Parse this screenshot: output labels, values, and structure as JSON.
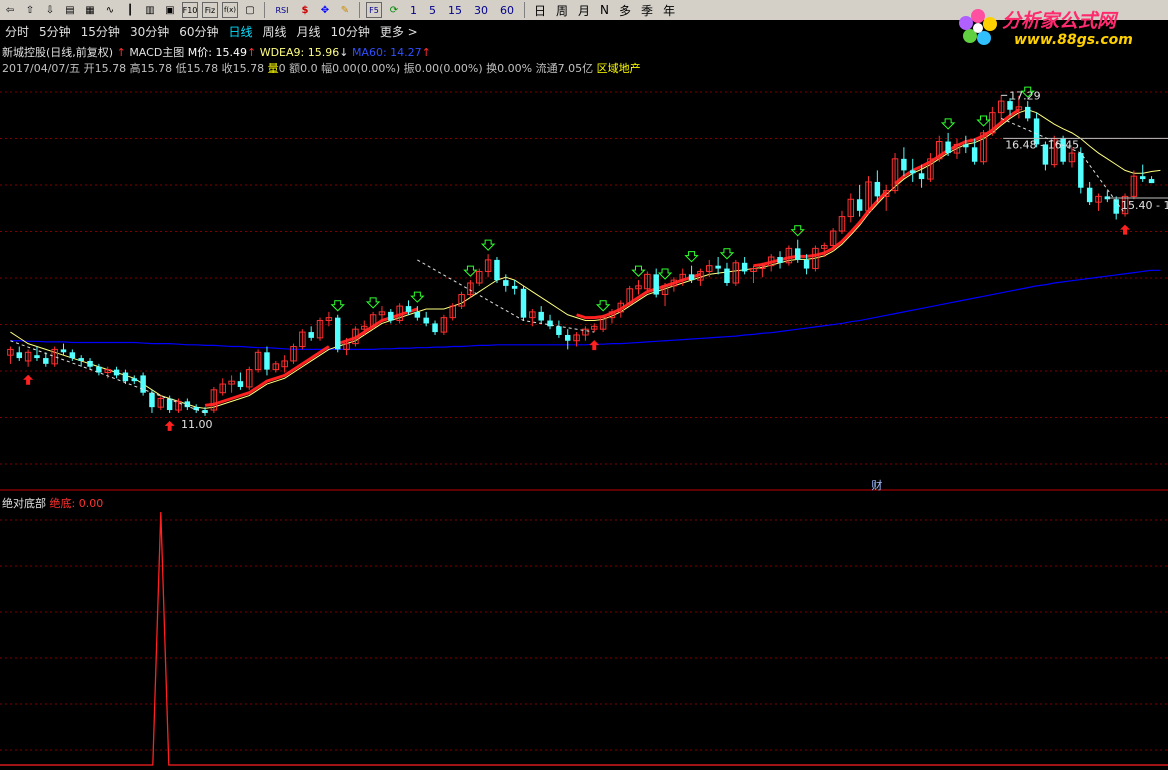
{
  "toolbar": {
    "icons": [
      "back-icon",
      "up-icon",
      "down-icon",
      "report-icon",
      "grid-icon",
      "line-icon",
      "candle-icon",
      "bar-icon",
      "doc-icon",
      "f10-icon",
      "fiz-icon",
      "fx-icon",
      "box-icon",
      "rsi-icon",
      "money-icon",
      "move-icon",
      "draw-icon",
      "f5-icon",
      "refresh-icon"
    ],
    "rsi_label": "RSI",
    "f10_label": "F10",
    "fiz_label": "Fiz",
    "fx_label": "f(x)",
    "f5_label": "F5",
    "minute_buttons": [
      "1",
      "5",
      "15",
      "30",
      "60"
    ],
    "period_buttons": [
      "日",
      "周",
      "月",
      "N",
      "多",
      "季",
      "年"
    ]
  },
  "periods": [
    "分时",
    "5分钟",
    "15分钟",
    "30分钟",
    "60分钟",
    "日线",
    "周线",
    "月线",
    "10分钟",
    "更多 >"
  ],
  "active_period": "日线",
  "logo": {
    "title": "分析家公式网",
    "url": "www.88gs.com"
  },
  "legend": {
    "stock": "新城控股(日线,前复权)",
    "arrow_up": "↑",
    "indicator": "MACD主图",
    "m_price": "M价: 15.49",
    "m_arrow": "↑",
    "wdea": "WDEA9: 15.96",
    "wdea_arrow": "↓",
    "ma60": "MA60: 14.27",
    "ma60_arrow": "↑"
  },
  "info": {
    "date": "2017/04/07/五",
    "open": "开15.78",
    "high": "高15.78",
    "low": "低15.78",
    "close": "收15.78",
    "vol_label": "量",
    "vol": "0",
    "amount": "额0.0",
    "range": "幅0.00(0.00%)",
    "amp": "振0.00(0.00%)",
    "turnover": "换0.00%",
    "float": "流通7.05亿",
    "sector": "区域地产"
  },
  "annotations": {
    "high_price": "17.29",
    "low_price": "11.00",
    "upper_range": "16.48 - 16.45",
    "lower_range": "15.40 - 15.",
    "cai_marker": "财"
  },
  "sub_legend": {
    "name": "绝对底部",
    "value": "绝底: 0.00"
  },
  "colors": {
    "up": "#ff3030",
    "down": "#54ffff",
    "ma_yellow": "#ffff80",
    "ma_blue": "#0000ff",
    "red_line": "#ff2020",
    "grid": "#800000"
  },
  "chart_data": {
    "type": "candlestick",
    "y_range": [
      10.5,
      17.6
    ],
    "candles": [
      {
        "o": 12.8,
        "h": 12.95,
        "l": 12.65,
        "c": 12.9
      },
      {
        "o": 12.85,
        "h": 12.95,
        "l": 12.7,
        "c": 12.75
      },
      {
        "o": 12.7,
        "h": 12.9,
        "l": 12.6,
        "c": 12.85
      },
      {
        "o": 12.8,
        "h": 12.95,
        "l": 12.7,
        "c": 12.75
      },
      {
        "o": 12.75,
        "h": 12.85,
        "l": 12.6,
        "c": 12.65
      },
      {
        "o": 12.65,
        "h": 12.95,
        "l": 12.6,
        "c": 12.9
      },
      {
        "o": 12.9,
        "h": 13.0,
        "l": 12.8,
        "c": 12.85
      },
      {
        "o": 12.85,
        "h": 12.9,
        "l": 12.7,
        "c": 12.75
      },
      {
        "o": 12.75,
        "h": 12.8,
        "l": 12.6,
        "c": 12.7
      },
      {
        "o": 12.7,
        "h": 12.75,
        "l": 12.55,
        "c": 12.6
      },
      {
        "o": 12.6,
        "h": 12.65,
        "l": 12.45,
        "c": 12.5
      },
      {
        "o": 12.5,
        "h": 12.6,
        "l": 12.4,
        "c": 12.55
      },
      {
        "o": 12.55,
        "h": 12.6,
        "l": 12.4,
        "c": 12.45
      },
      {
        "o": 12.5,
        "h": 12.55,
        "l": 12.3,
        "c": 12.35
      },
      {
        "o": 12.4,
        "h": 12.45,
        "l": 12.3,
        "c": 12.35
      },
      {
        "o": 12.45,
        "h": 12.5,
        "l": 12.1,
        "c": 12.15
      },
      {
        "o": 12.15,
        "h": 12.2,
        "l": 11.8,
        "c": 11.9
      },
      {
        "o": 11.9,
        "h": 12.1,
        "l": 11.85,
        "c": 12.05
      },
      {
        "o": 12.05,
        "h": 12.1,
        "l": 11.8,
        "c": 11.85
      },
      {
        "o": 11.85,
        "h": 12.05,
        "l": 11.8,
        "c": 12.0
      },
      {
        "o": 12.0,
        "h": 12.05,
        "l": 11.85,
        "c": 11.9
      },
      {
        "o": 11.9,
        "h": 11.95,
        "l": 11.8,
        "c": 11.85
      },
      {
        "o": 11.85,
        "h": 11.9,
        "l": 11.75,
        "c": 11.8
      },
      {
        "o": 11.85,
        "h": 12.25,
        "l": 11.8,
        "c": 12.2
      },
      {
        "o": 12.15,
        "h": 12.4,
        "l": 12.1,
        "c": 12.3
      },
      {
        "o": 12.3,
        "h": 12.45,
        "l": 12.15,
        "c": 12.35
      },
      {
        "o": 12.35,
        "h": 12.5,
        "l": 12.2,
        "c": 12.25
      },
      {
        "o": 12.25,
        "h": 12.6,
        "l": 12.2,
        "c": 12.55
      },
      {
        "o": 12.55,
        "h": 12.9,
        "l": 12.5,
        "c": 12.85
      },
      {
        "o": 12.85,
        "h": 12.95,
        "l": 12.45,
        "c": 12.55
      },
      {
        "o": 12.55,
        "h": 12.7,
        "l": 12.5,
        "c": 12.65
      },
      {
        "o": 12.6,
        "h": 12.8,
        "l": 12.5,
        "c": 12.7
      },
      {
        "o": 12.7,
        "h": 13.0,
        "l": 12.65,
        "c": 12.95
      },
      {
        "o": 12.95,
        "h": 13.25,
        "l": 12.9,
        "c": 13.2
      },
      {
        "o": 13.2,
        "h": 13.3,
        "l": 13.05,
        "c": 13.1
      },
      {
        "o": 13.1,
        "h": 13.45,
        "l": 13.05,
        "c": 13.4
      },
      {
        "o": 13.4,
        "h": 13.55,
        "l": 13.3,
        "c": 13.45
      },
      {
        "o": 13.45,
        "h": 13.5,
        "l": 12.85,
        "c": 12.9
      },
      {
        "o": 12.9,
        "h": 13.1,
        "l": 12.8,
        "c": 13.0
      },
      {
        "o": 13.0,
        "h": 13.3,
        "l": 12.95,
        "c": 13.25
      },
      {
        "o": 13.25,
        "h": 13.4,
        "l": 13.15,
        "c": 13.3
      },
      {
        "o": 13.3,
        "h": 13.55,
        "l": 13.25,
        "c": 13.5
      },
      {
        "o": 13.5,
        "h": 13.65,
        "l": 13.4,
        "c": 13.55
      },
      {
        "o": 13.55,
        "h": 13.6,
        "l": 13.35,
        "c": 13.4
      },
      {
        "o": 13.4,
        "h": 13.7,
        "l": 13.35,
        "c": 13.65
      },
      {
        "o": 13.65,
        "h": 13.75,
        "l": 13.5,
        "c": 13.55
      },
      {
        "o": 13.55,
        "h": 13.65,
        "l": 13.4,
        "c": 13.45
      },
      {
        "o": 13.45,
        "h": 13.55,
        "l": 13.3,
        "c": 13.35
      },
      {
        "o": 13.35,
        "h": 13.4,
        "l": 13.15,
        "c": 13.2
      },
      {
        "o": 13.2,
        "h": 13.5,
        "l": 13.15,
        "c": 13.45
      },
      {
        "o": 13.45,
        "h": 13.7,
        "l": 13.4,
        "c": 13.65
      },
      {
        "o": 13.65,
        "h": 13.9,
        "l": 13.6,
        "c": 13.85
      },
      {
        "o": 13.85,
        "h": 14.1,
        "l": 13.8,
        "c": 14.05
      },
      {
        "o": 14.05,
        "h": 14.3,
        "l": 14.0,
        "c": 14.25
      },
      {
        "o": 14.25,
        "h": 14.55,
        "l": 14.15,
        "c": 14.45
      },
      {
        "o": 14.45,
        "h": 14.5,
        "l": 14.05,
        "c": 14.1
      },
      {
        "o": 14.1,
        "h": 14.2,
        "l": 13.9,
        "c": 14.0
      },
      {
        "o": 14.0,
        "h": 14.1,
        "l": 13.85,
        "c": 13.95
      },
      {
        "o": 13.95,
        "h": 14.0,
        "l": 13.4,
        "c": 13.45
      },
      {
        "o": 13.45,
        "h": 13.6,
        "l": 13.3,
        "c": 13.55
      },
      {
        "o": 13.55,
        "h": 13.65,
        "l": 13.35,
        "c": 13.4
      },
      {
        "o": 13.4,
        "h": 13.5,
        "l": 13.25,
        "c": 13.3
      },
      {
        "o": 13.3,
        "h": 13.4,
        "l": 13.1,
        "c": 13.15
      },
      {
        "o": 13.15,
        "h": 13.25,
        "l": 12.9,
        "c": 13.05
      },
      {
        "o": 13.05,
        "h": 13.2,
        "l": 12.95,
        "c": 13.15
      },
      {
        "o": 13.15,
        "h": 13.3,
        "l": 13.05,
        "c": 13.25
      },
      {
        "o": 13.25,
        "h": 13.35,
        "l": 13.2,
        "c": 13.3
      },
      {
        "o": 13.25,
        "h": 13.5,
        "l": 13.2,
        "c": 13.45
      },
      {
        "o": 13.45,
        "h": 13.6,
        "l": 13.35,
        "c": 13.55
      },
      {
        "o": 13.55,
        "h": 13.75,
        "l": 13.45,
        "c": 13.7
      },
      {
        "o": 13.7,
        "h": 14.0,
        "l": 13.65,
        "c": 13.95
      },
      {
        "o": 13.95,
        "h": 14.1,
        "l": 13.85,
        "c": 14.0
      },
      {
        "o": 13.95,
        "h": 14.25,
        "l": 13.9,
        "c": 14.2
      },
      {
        "o": 14.2,
        "h": 14.3,
        "l": 13.8,
        "c": 13.85
      },
      {
        "o": 13.85,
        "h": 14.05,
        "l": 13.65,
        "c": 14.0
      },
      {
        "o": 14.0,
        "h": 14.15,
        "l": 13.9,
        "c": 14.1
      },
      {
        "o": 14.1,
        "h": 14.3,
        "l": 14.0,
        "c": 14.2
      },
      {
        "o": 14.2,
        "h": 14.35,
        "l": 14.05,
        "c": 14.1
      },
      {
        "o": 14.1,
        "h": 14.3,
        "l": 14.0,
        "c": 14.25
      },
      {
        "o": 14.25,
        "h": 14.45,
        "l": 14.15,
        "c": 14.35
      },
      {
        "o": 14.35,
        "h": 14.5,
        "l": 14.2,
        "c": 14.3
      },
      {
        "o": 14.3,
        "h": 14.4,
        "l": 14.0,
        "c": 14.05
      },
      {
        "o": 14.05,
        "h": 14.45,
        "l": 14.0,
        "c": 14.4
      },
      {
        "o": 14.4,
        "h": 14.5,
        "l": 14.2,
        "c": 14.25
      },
      {
        "o": 14.25,
        "h": 14.35,
        "l": 14.05,
        "c": 14.3
      },
      {
        "o": 14.3,
        "h": 14.4,
        "l": 14.15,
        "c": 14.35
      },
      {
        "o": 14.35,
        "h": 14.55,
        "l": 14.25,
        "c": 14.5
      },
      {
        "o": 14.5,
        "h": 14.6,
        "l": 14.3,
        "c": 14.4
      },
      {
        "o": 14.4,
        "h": 14.7,
        "l": 14.35,
        "c": 14.65
      },
      {
        "o": 14.65,
        "h": 14.8,
        "l": 14.4,
        "c": 14.45
      },
      {
        "o": 14.45,
        "h": 14.55,
        "l": 14.2,
        "c": 14.3
      },
      {
        "o": 14.3,
        "h": 14.7,
        "l": 14.25,
        "c": 14.65
      },
      {
        "o": 14.65,
        "h": 14.75,
        "l": 14.5,
        "c": 14.7
      },
      {
        "o": 14.7,
        "h": 15.0,
        "l": 14.6,
        "c": 14.95
      },
      {
        "o": 14.95,
        "h": 15.3,
        "l": 14.9,
        "c": 15.2
      },
      {
        "o": 15.2,
        "h": 15.6,
        "l": 15.1,
        "c": 15.5
      },
      {
        "o": 15.5,
        "h": 15.75,
        "l": 15.2,
        "c": 15.3
      },
      {
        "o": 15.3,
        "h": 15.9,
        "l": 15.25,
        "c": 15.8
      },
      {
        "o": 15.8,
        "h": 16.0,
        "l": 15.45,
        "c": 15.55
      },
      {
        "o": 15.55,
        "h": 15.75,
        "l": 15.3,
        "c": 15.65
      },
      {
        "o": 15.65,
        "h": 16.3,
        "l": 15.6,
        "c": 16.2
      },
      {
        "o": 16.2,
        "h": 16.4,
        "l": 15.9,
        "c": 16.0
      },
      {
        "o": 16.0,
        "h": 16.2,
        "l": 15.8,
        "c": 15.95
      },
      {
        "o": 15.95,
        "h": 16.1,
        "l": 15.7,
        "c": 15.85
      },
      {
        "o": 15.85,
        "h": 16.3,
        "l": 15.8,
        "c": 16.2
      },
      {
        "o": 16.2,
        "h": 16.6,
        "l": 16.15,
        "c": 16.5
      },
      {
        "o": 16.5,
        "h": 16.65,
        "l": 16.25,
        "c": 16.3
      },
      {
        "o": 16.3,
        "h": 16.55,
        "l": 16.2,
        "c": 16.45
      },
      {
        "o": 16.45,
        "h": 16.6,
        "l": 16.3,
        "c": 16.4
      },
      {
        "o": 16.4,
        "h": 16.55,
        "l": 16.1,
        "c": 16.15
      },
      {
        "o": 16.15,
        "h": 16.7,
        "l": 16.1,
        "c": 16.65
      },
      {
        "o": 16.65,
        "h": 17.1,
        "l": 16.6,
        "c": 17.0
      },
      {
        "o": 17.0,
        "h": 17.3,
        "l": 16.85,
        "c": 17.2
      },
      {
        "o": 17.2,
        "h": 17.25,
        "l": 16.95,
        "c": 17.05
      },
      {
        "o": 17.05,
        "h": 17.29,
        "l": 16.9,
        "c": 17.1
      },
      {
        "o": 17.1,
        "h": 17.2,
        "l": 16.85,
        "c": 16.9
      },
      {
        "o": 16.9,
        "h": 17.0,
        "l": 16.4,
        "c": 16.45
      },
      {
        "o": 16.45,
        "h": 16.5,
        "l": 16.0,
        "c": 16.1
      },
      {
        "o": 16.1,
        "h": 16.6,
        "l": 16.05,
        "c": 16.55
      },
      {
        "o": 16.55,
        "h": 16.6,
        "l": 16.1,
        "c": 16.15
      },
      {
        "o": 16.15,
        "h": 16.4,
        "l": 16.05,
        "c": 16.3
      },
      {
        "o": 16.3,
        "h": 16.4,
        "l": 15.6,
        "c": 15.7
      },
      {
        "o": 15.7,
        "h": 15.8,
        "l": 15.4,
        "c": 15.45
      },
      {
        "o": 15.45,
        "h": 15.6,
        "l": 15.3,
        "c": 15.55
      },
      {
        "o": 15.55,
        "h": 15.65,
        "l": 15.45,
        "c": 15.5
      },
      {
        "o": 15.5,
        "h": 15.55,
        "l": 15.15,
        "c": 15.25
      },
      {
        "o": 15.25,
        "h": 15.6,
        "l": 15.2,
        "c": 15.55
      },
      {
        "o": 15.55,
        "h": 16.0,
        "l": 15.5,
        "c": 15.9
      },
      {
        "o": 15.9,
        "h": 16.1,
        "l": 15.8,
        "c": 15.85
      },
      {
        "o": 15.85,
        "h": 15.9,
        "l": 15.78,
        "c": 15.78
      }
    ],
    "ma_short": [
      13.2,
      13.1,
      13.0,
      12.95,
      12.9,
      12.85,
      12.8,
      12.75,
      12.7,
      12.65,
      12.6,
      12.55,
      12.5,
      12.45,
      12.4,
      12.3,
      12.2,
      12.1,
      12.05,
      12.0,
      11.95,
      11.9,
      11.88,
      11.9,
      11.95,
      12.0,
      12.05,
      12.1,
      12.2,
      12.3,
      12.35,
      12.4,
      12.5,
      12.6,
      12.7,
      12.8,
      12.9,
      12.95,
      13.0,
      13.05,
      13.15,
      13.25,
      13.35,
      13.4,
      13.45,
      13.5,
      13.55,
      13.6,
      13.6,
      13.6,
      13.65,
      13.7,
      13.8,
      13.9,
      14.0,
      14.1,
      14.15,
      14.1,
      14.0,
      13.9,
      13.8,
      13.7,
      13.6,
      13.5,
      13.45,
      13.4,
      13.4,
      13.42,
      13.48,
      13.55,
      13.65,
      13.75,
      13.85,
      13.9,
      13.95,
      14.0,
      14.05,
      14.1,
      14.15,
      14.2,
      14.22,
      14.24,
      14.26,
      14.28,
      14.3,
      14.32,
      14.36,
      14.4,
      14.44,
      14.46,
      14.46,
      14.48,
      14.52,
      14.6,
      14.72,
      14.88,
      15.05,
      15.25,
      15.42,
      15.58,
      15.72,
      15.85,
      15.95,
      16.02,
      16.1,
      16.2,
      16.3,
      16.38,
      16.45,
      16.48,
      16.55,
      16.65,
      16.78,
      16.9,
      17.0,
      17.05,
      17.0,
      16.9,
      16.8,
      16.72,
      16.65,
      16.55,
      16.42,
      16.3,
      16.2,
      16.1,
      16.0,
      15.95,
      15.95,
      15.98,
      16.0
    ],
    "ma60": [
      13.05,
      13.05,
      13.04,
      13.04,
      13.03,
      13.03,
      13.03,
      13.02,
      13.02,
      13.02,
      13.02,
      13.02,
      13.02,
      13.02,
      13.02,
      13.01,
      13.0,
      13.0,
      13.0,
      12.99,
      12.98,
      12.98,
      12.97,
      12.97,
      12.96,
      12.95,
      12.95,
      12.94,
      12.93,
      12.93,
      12.92,
      12.91,
      12.9,
      12.9,
      12.9,
      12.9,
      12.9,
      12.9,
      12.9,
      12.9,
      12.9,
      12.9,
      12.91,
      12.91,
      12.92,
      12.92,
      12.93,
      12.93,
      12.94,
      12.94,
      12.95,
      12.95,
      12.96,
      12.97,
      12.97,
      12.98,
      12.98,
      12.98,
      12.98,
      12.98,
      12.98,
      12.98,
      12.98,
      12.98,
      12.98,
      12.98,
      12.99,
      12.99,
      13.0,
      13.0,
      13.01,
      13.02,
      13.03,
      13.04,
      13.05,
      13.06,
      13.07,
      13.08,
      13.09,
      13.1,
      13.11,
      13.12,
      13.13,
      13.15,
      13.16,
      13.18,
      13.19,
      13.21,
      13.23,
      13.25,
      13.27,
      13.29,
      13.31,
      13.33,
      13.35,
      13.38,
      13.4,
      13.43,
      13.46,
      13.49,
      13.52,
      13.55,
      13.58,
      13.61,
      13.64,
      13.67,
      13.7,
      13.73,
      13.76,
      13.79,
      13.82,
      13.85,
      13.88,
      13.91,
      13.94,
      13.97,
      14.0,
      14.02,
      14.05,
      14.07,
      14.09,
      14.11,
      14.13,
      14.15,
      14.17,
      14.19,
      14.21,
      14.23,
      14.25,
      14.27,
      14.27
    ],
    "sub_indicator": {
      "name": "绝对底部",
      "spike_index": 17,
      "spike_value": 1.0
    }
  }
}
